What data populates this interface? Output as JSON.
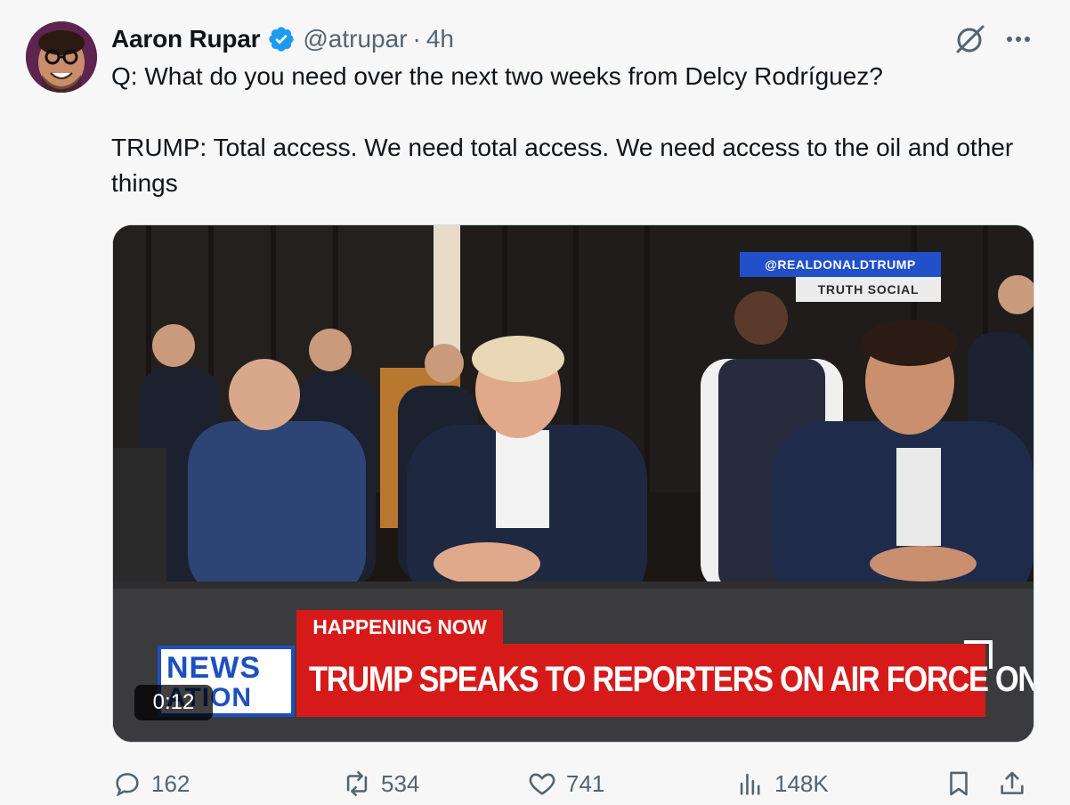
{
  "tweet": {
    "author_name": "Aaron Rupar",
    "handle": "@atrupar",
    "separator": "·",
    "time": "4h",
    "verified": true,
    "text_lines": [
      "Q: What do you need over the next two weeks from Delcy Rodríguez?",
      "TRUMP: Total access. We need total access. We need access to the oil and other things"
    ]
  },
  "video": {
    "overlay_handle": "@REALDONALDTRUMP",
    "overlay_platform": "TRUTH SOCIAL",
    "lower_third_tag": "HAPPENING NOW",
    "headline": "TRUMP SPEAKS TO REPORTERS ON AIR FORCE ONE",
    "network_line1": "NEWS",
    "network_line2": "ATION",
    "duration": "0:12"
  },
  "actions": {
    "replies": "162",
    "reposts": "534",
    "likes": "741",
    "views": "148K"
  },
  "colors": {
    "accent_blue": "#1d9bf0",
    "breaking_red": "#d61a1a",
    "network_blue": "#1d4fc0",
    "muted_text": "#536471"
  },
  "icons": [
    "verified-badge-icon",
    "grok-icon",
    "more-icon",
    "reply-icon",
    "repost-icon",
    "like-icon",
    "views-icon",
    "bookmark-icon",
    "share-icon"
  ]
}
